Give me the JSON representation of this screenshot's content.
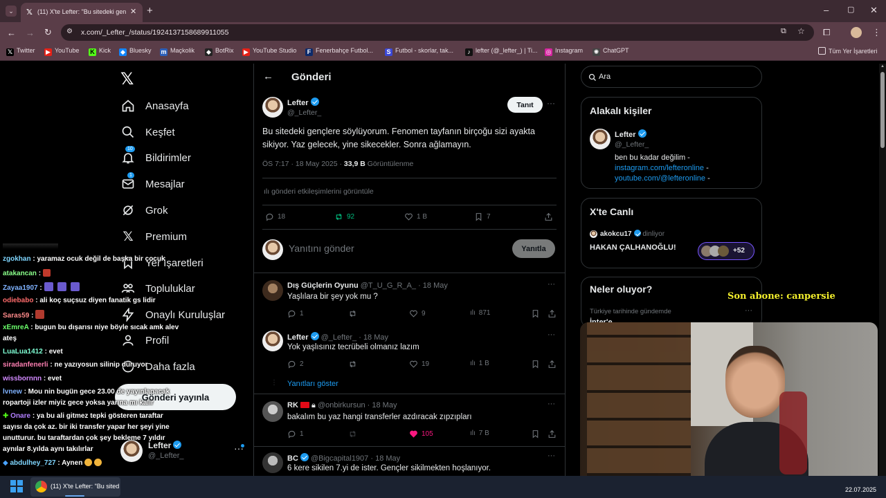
{
  "browser": {
    "tab_title": "(11) X'te Lefter: \"Bu sitedeki gen",
    "url": "x.com/_Lefter_/status/1924137158689911055",
    "bookmarks": [
      "Twitter",
      "YouTube",
      "Kick",
      "Bluesky",
      "Maçkolik",
      "BotRix",
      "YouTube Studio",
      "Fenerbahçe Futbol...",
      "Futbol - skorlar, tak...",
      "lefter (@_lefter_) | Ti...",
      "Instagram",
      "ChatGPT"
    ],
    "all_bookmarks": "Tüm Yer İşaretleri"
  },
  "nav": {
    "home": "Anasayfa",
    "explore": "Keşfet",
    "notifications": "Bildirimler",
    "notif_count": "10",
    "messages": "Mesajlar",
    "msg_count": "1",
    "grok": "Grok",
    "premium": "Premium",
    "bookmarks": "Yer İşaretleri",
    "communities": "Topluluklar",
    "verified_orgs": "Onaylı Kuruluşlar",
    "profile": "Profil",
    "more": "Daha fazla",
    "post_button": "Gönderi yayınla",
    "account_name": "Lefter",
    "account_handle": "@_Lefter_"
  },
  "post": {
    "header_title": "Gönderi",
    "author": "Lefter",
    "handle": "@_Lefter_",
    "follow_label": "Tanıt",
    "text": "Bu sitedeki gençlere söylüyorum. Fenomen tayfanın birçoğu sizi ayakta sikiyor. Yaz gelecek, yine sikecekler. Sonra ağlamayın.",
    "time": "ÖS 7:17 · 18 May 2025 ·",
    "views": "33,9 B",
    "views_label": "Görüntülenme",
    "engagements": "gönderi etkileşimlerini görüntüle",
    "replies": "18",
    "reposts": "92",
    "likes": "1 B",
    "bookmarks": "7",
    "reply_placeholder": "Yanıtını gönder",
    "reply_button": "Yanıtla"
  },
  "replies": [
    {
      "name": "Dış Güçlerin Oyunu",
      "handle": "@T_U_G_R_A_",
      "date": "· 18 May",
      "text": "Yaşlılara bir şey yok mu ?",
      "replies": "1",
      "reposts": "",
      "likes": "9",
      "views": "871"
    },
    {
      "name": "Lefter",
      "handle": "@_Lefter_",
      "date": "· 18 May",
      "text": "Yok yaşlısınız tecrübeli olmanız lazım",
      "replies": "2",
      "reposts": "",
      "likes": "19",
      "views": "1 B",
      "show_replies": "Yanıtları göster"
    },
    {
      "name": "RK",
      "handle": "@onbirkursun",
      "date": "· 18 May",
      "text": "bakalım bu yaz hangi transferler azdıracak zıpzıpları",
      "replies": "1",
      "reposts": "",
      "likes": "105",
      "views": "7 B"
    },
    {
      "name": "BC",
      "handle": "@Bigcapital1907",
      "date": "· 18 May",
      "text": "6 kere sikilen 7.yi de ister. Gençler sikilmekten hoşlanıyor."
    }
  ],
  "sidebar": {
    "search_placeholder": "Ara",
    "relevant_title": "Alakalı kişiler",
    "person_name": "Lefter",
    "person_handle": "@_Lefter_",
    "bio_line1": "ben bu kadar değilim -",
    "bio_link1": "instagram.com/lefteronline",
    "bio_link2": "youtube.com/@lefteronline",
    "bio_dash": "-",
    "live_title": "X'te Canlı",
    "live_user": "akokcu17",
    "live_status": "dinliyor",
    "live_topic": "HAKAN ÇALHANOĞLU!",
    "live_count": "+52",
    "trends_title": "Neler oluyor?",
    "trend_meta": "Türkiye tarihinde gündemde",
    "trend_name": "İnter'e"
  },
  "overlay": {
    "last_sub": "Son abone: canpersie",
    "chat": [
      {
        "user": "zgokhan",
        "msg": " : yaramaz ocuk değil de başka bir çocuk",
        "color": "#7fd6ff"
      },
      {
        "user": "atakancan",
        "msg": " :",
        "color": "#8aff8a"
      },
      {
        "user": "Zayaa1907",
        "msg": " :",
        "color": "#7fb2ff"
      },
      {
        "user": "odiebabo",
        "msg": " : ali koç suçsuz diyen fanatik gs lidir",
        "color": "#ff6b6b"
      },
      {
        "user": "Saras59",
        "msg": " :",
        "color": "#ff8a8a"
      },
      {
        "user": "xEmreA",
        "msg": " : bugun bu dışarısı niye böyle sıcak amk alev",
        "color": "#6bff6b"
      },
      {
        "user": "",
        "msg": "ateş",
        "color": "#fff"
      },
      {
        "user": "LuaLua1412",
        "msg": " : evet",
        "color": "#7fffd4"
      },
      {
        "user": "siradanfenerli",
        "msg": " : ne yazıyosun silinip duruyor",
        "color": "#ff7fb2"
      },
      {
        "user": "wissbornnn",
        "msg": " : evet",
        "color": "#d28aff"
      },
      {
        "user": "lvnew",
        "msg": " : Mou nin bugün gece 23.00 de yayınlanacak",
        "color": "#7fb2ff"
      },
      {
        "user": "",
        "msg": "ropartoji izler miyiz gece yoksa yarına mı kalır",
        "color": "#fff"
      },
      {
        "user": "Onare",
        "msg": " : ya bu ali gitmez tepki gösteren taraftar",
        "color": "#b27fff"
      },
      {
        "user": "",
        "msg": "sayısı da çok az. bir iki transfer yapar her şeyi yine",
        "color": "#fff"
      },
      {
        "user": "",
        "msg": "unutturur. bu taraftardan çok şey bekleme 7 yıldır",
        "color": "#fff"
      },
      {
        "user": "",
        "msg": "aynılar 8.yılda aynı takılırlar",
        "color": "#fff"
      },
      {
        "user": "abdulhey_727",
        "msg": " : Aynen",
        "color": "#7fd6ff"
      }
    ]
  },
  "taskbar": {
    "window_title": "(11) X'te Lefter: \"Bu sited",
    "date": "22.07.2025"
  }
}
